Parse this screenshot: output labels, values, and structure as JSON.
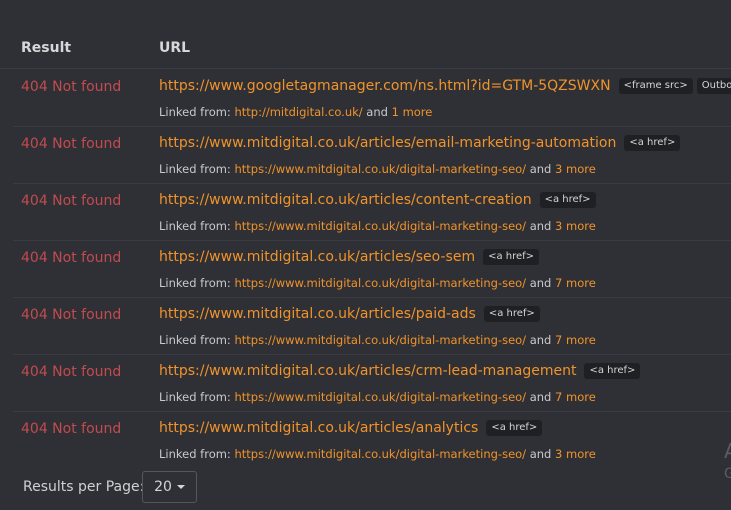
{
  "table": {
    "headers": {
      "result": "Result",
      "url": "URL"
    },
    "rows": [
      {
        "result": "404 Not found",
        "url": "https://www.googletagmanager.com/ns.html?id=GTM-5QZSWXN",
        "tags": [
          "<frame src>",
          "Outbound"
        ],
        "linked_prefix": "Linked from:",
        "linked_url": "http://mitdigital.co.uk/",
        "and_text": "and",
        "more_text": "1 more"
      },
      {
        "result": "404 Not found",
        "url": "https://www.mitdigital.co.uk/articles/email-marketing-automation",
        "tags": [
          "<a href>"
        ],
        "linked_prefix": "Linked from:",
        "linked_url": "https://www.mitdigital.co.uk/digital-marketing-seo/",
        "and_text": "and",
        "more_text": "3 more"
      },
      {
        "result": "404 Not found",
        "url": "https://www.mitdigital.co.uk/articles/content-creation",
        "tags": [
          "<a href>"
        ],
        "linked_prefix": "Linked from:",
        "linked_url": "https://www.mitdigital.co.uk/digital-marketing-seo/",
        "and_text": "and",
        "more_text": "3 more"
      },
      {
        "result": "404 Not found",
        "url": "https://www.mitdigital.co.uk/articles/seo-sem",
        "tags": [
          "<a href>"
        ],
        "linked_prefix": "Linked from:",
        "linked_url": "https://www.mitdigital.co.uk/digital-marketing-seo/",
        "and_text": "and",
        "more_text": "7 more"
      },
      {
        "result": "404 Not found",
        "url": "https://www.mitdigital.co.uk/articles/paid-ads",
        "tags": [
          "<a href>"
        ],
        "linked_prefix": "Linked from:",
        "linked_url": "https://www.mitdigital.co.uk/digital-marketing-seo/",
        "and_text": "and",
        "more_text": "7 more"
      },
      {
        "result": "404 Not found",
        "url": "https://www.mitdigital.co.uk/articles/crm-lead-management",
        "tags": [
          "<a href>"
        ],
        "linked_prefix": "Linked from:",
        "linked_url": "https://www.mitdigital.co.uk/digital-marketing-seo/",
        "and_text": "and",
        "more_text": "7 more"
      },
      {
        "result": "404 Not found",
        "url": "https://www.mitdigital.co.uk/articles/analytics",
        "tags": [
          "<a href>"
        ],
        "linked_prefix": "Linked from:",
        "linked_url": "https://www.mitdigital.co.uk/digital-marketing-seo/",
        "and_text": "and",
        "more_text": "3 more"
      }
    ]
  },
  "footer": {
    "results_per_page_label": "Results per Page:",
    "results_per_page_value": "20"
  },
  "colors": {
    "background": "#2f3035",
    "error": "#c24b4f",
    "link": "#f0932b",
    "tag_bg": "#1f2024"
  }
}
